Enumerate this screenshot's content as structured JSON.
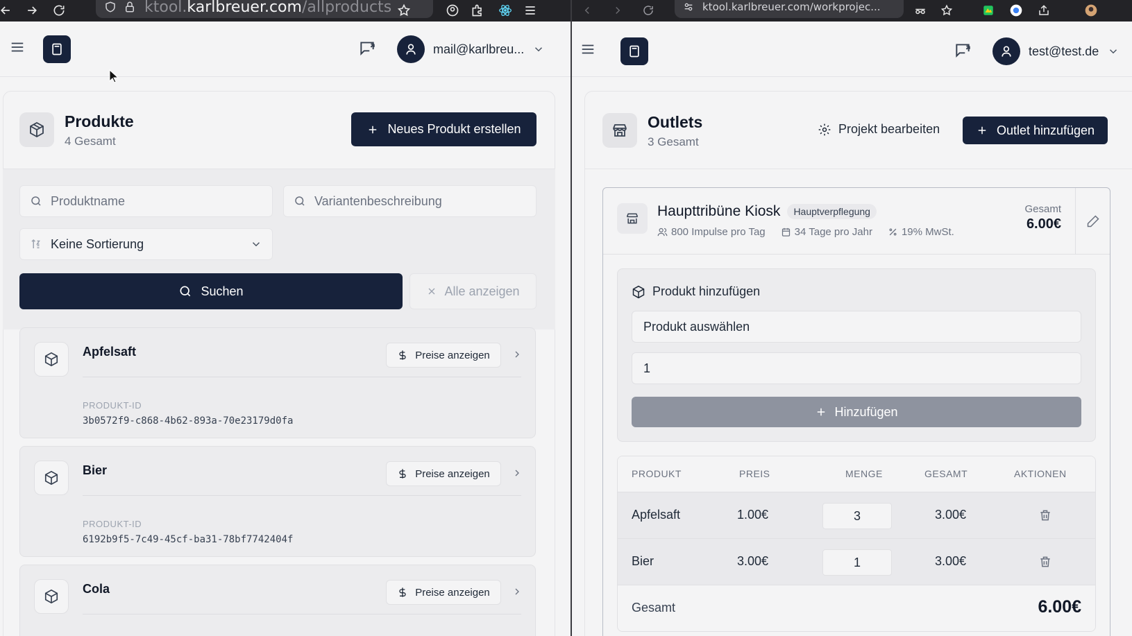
{
  "left": {
    "browser": {
      "url_prefix": "ktool.",
      "url_domain": "karlbreuer.com",
      "url_path": "/allproducts"
    },
    "header": {
      "user_email": "mail@karlbreu..."
    },
    "panel": {
      "title": "Produkte",
      "subtitle": "4 Gesamt",
      "new_button": "Neues Produkt erstellen",
      "search_name_placeholder": "Produktname",
      "search_variant_placeholder": "Variantenbeschreibung",
      "sort_value": "Keine Sortierung",
      "search_button": "Suchen",
      "show_all_button": "Alle anzeigen"
    },
    "products": [
      {
        "name": "Apfelsaft",
        "price_button": "Preise anzeigen",
        "id_label": "PRODUKT-ID",
        "id": "3b0572f9-c868-4b62-893a-70e23179d0fa"
      },
      {
        "name": "Bier",
        "price_button": "Preise anzeigen",
        "id_label": "PRODUKT-ID",
        "id": "6192b9f5-7c49-45cf-ba31-78bf7742404f"
      },
      {
        "name": "Cola",
        "price_button": "Preise anzeigen"
      }
    ]
  },
  "right": {
    "browser": {
      "url": "ktool.karlbreuer.com/workprojec..."
    },
    "header": {
      "user_email": "test@test.de"
    },
    "panel": {
      "title": "Outlets",
      "subtitle": "3 Gesamt",
      "edit_button": "Projekt bearbeiten",
      "add_button": "Outlet hinzufügen"
    },
    "outlet": {
      "name": "Haupttribüne Kiosk",
      "tag": "Hauptverpflegung",
      "impulses": "800 Impulse pro Tag",
      "days": "34 Tage pro Jahr",
      "vat": "19% MwSt.",
      "total_label": "Gesamt",
      "total_value": "6.00€",
      "add_product": {
        "title": "Produkt hinzufügen",
        "select_value": "Produkt auswählen",
        "qty_value": "1",
        "add_button": "Hinzufügen"
      },
      "table": {
        "headers": [
          "PRODUKT",
          "PREIS",
          "MENGE",
          "GESAMT",
          "AKTIONEN"
        ],
        "rows": [
          {
            "product": "Apfelsaft",
            "price": "1.00€",
            "qty": "3",
            "total": "3.00€"
          },
          {
            "product": "Bier",
            "price": "3.00€",
            "qty": "1",
            "total": "3.00€"
          }
        ],
        "footer_label": "Gesamt",
        "footer_value": "6.00€"
      }
    }
  }
}
